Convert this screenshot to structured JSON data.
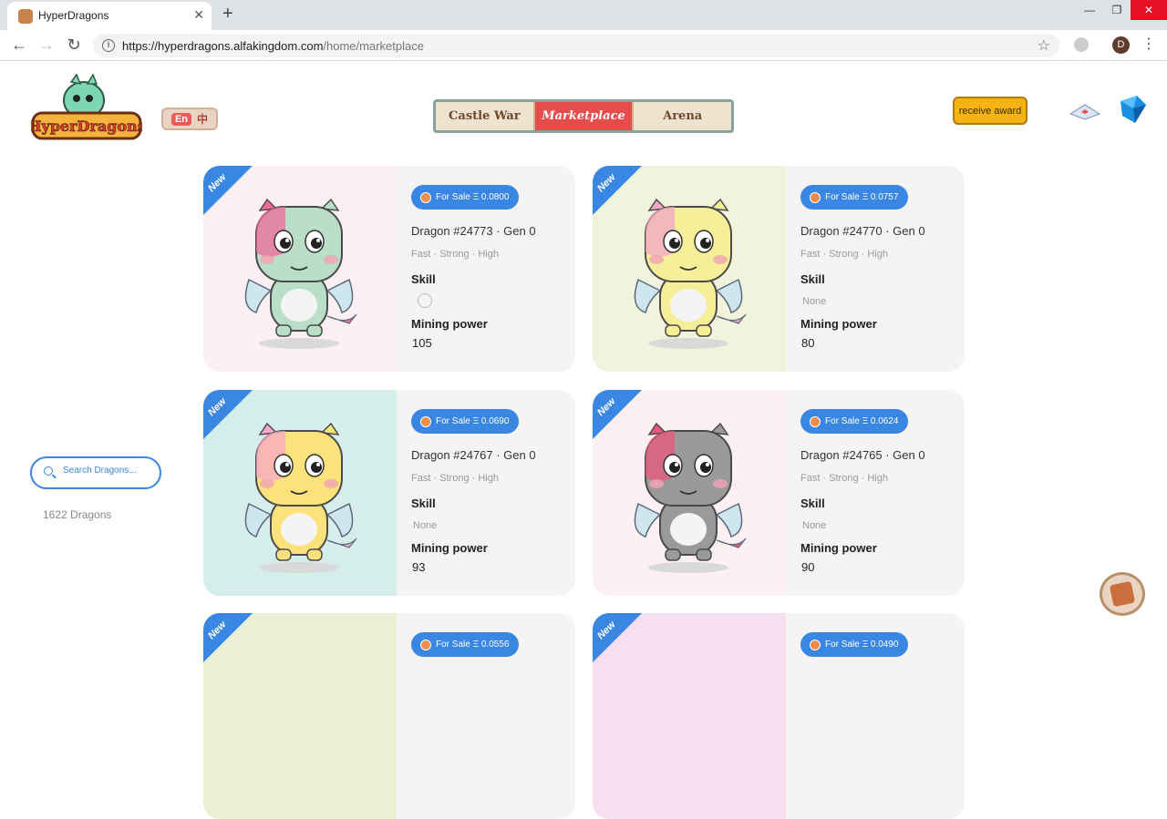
{
  "browser": {
    "tab_title": "HyperDragons",
    "tab_close": "✕",
    "new_tab": "+",
    "url_host": "https://hyperdragons.alfakingdom.com",
    "url_path": "/home/marketplace",
    "profile_initial": "D",
    "win_min": "—",
    "win_max": "❐",
    "win_close": "✕"
  },
  "header": {
    "lang_en": "En",
    "lang_zh": "中",
    "nav": [
      "Castle War",
      "Marketplace",
      "Arena"
    ],
    "active_nav": "Marketplace",
    "award_label": "receive award"
  },
  "sidebar": {
    "search_placeholder": "Search Dragons...",
    "count_label": "1622 Dragons"
  },
  "labels": {
    "new": "New",
    "skill": "Skill",
    "mining_power": "Mining power"
  },
  "dragons": [
    {
      "sale": "For Sale Ξ 0.0800",
      "name": "Dragon #24773 · Gen 0",
      "traits": "Fast · Strong · High",
      "skill": "",
      "mining": "105",
      "bg": "#fdf0f3",
      "body": "#b9dfc8",
      "accent": "#f06a9a"
    },
    {
      "sale": "For Sale Ξ 0.0757",
      "name": "Dragon #24770 · Gen 0",
      "traits": "Fast · Strong · High",
      "skill": "None",
      "mining": "80",
      "bg": "#f1f3dc",
      "body": "#f6ef9a",
      "accent": "#f3a6c6"
    },
    {
      "sale": "For Sale Ξ 0.0690",
      "name": "Dragon #24767 · Gen 0",
      "traits": "Fast · Strong · High",
      "skill": "None",
      "mining": "93",
      "bg": "#d5edeb",
      "body": "#fbe27a",
      "accent": "#f7a8c9"
    },
    {
      "sale": "For Sale Ξ 0.0624",
      "name": "Dragon #24765 · Gen 0",
      "traits": "Fast · Strong · High",
      "skill": "None",
      "mining": "90",
      "bg": "#fdf0f3",
      "body": "#9a9a9a",
      "accent": "#e8587c"
    },
    {
      "sale": "For Sale Ξ 0.0556",
      "bg": "#e9f0d6"
    },
    {
      "sale": "For Sale Ξ 0.0490",
      "bg": "#f5dff0"
    }
  ]
}
